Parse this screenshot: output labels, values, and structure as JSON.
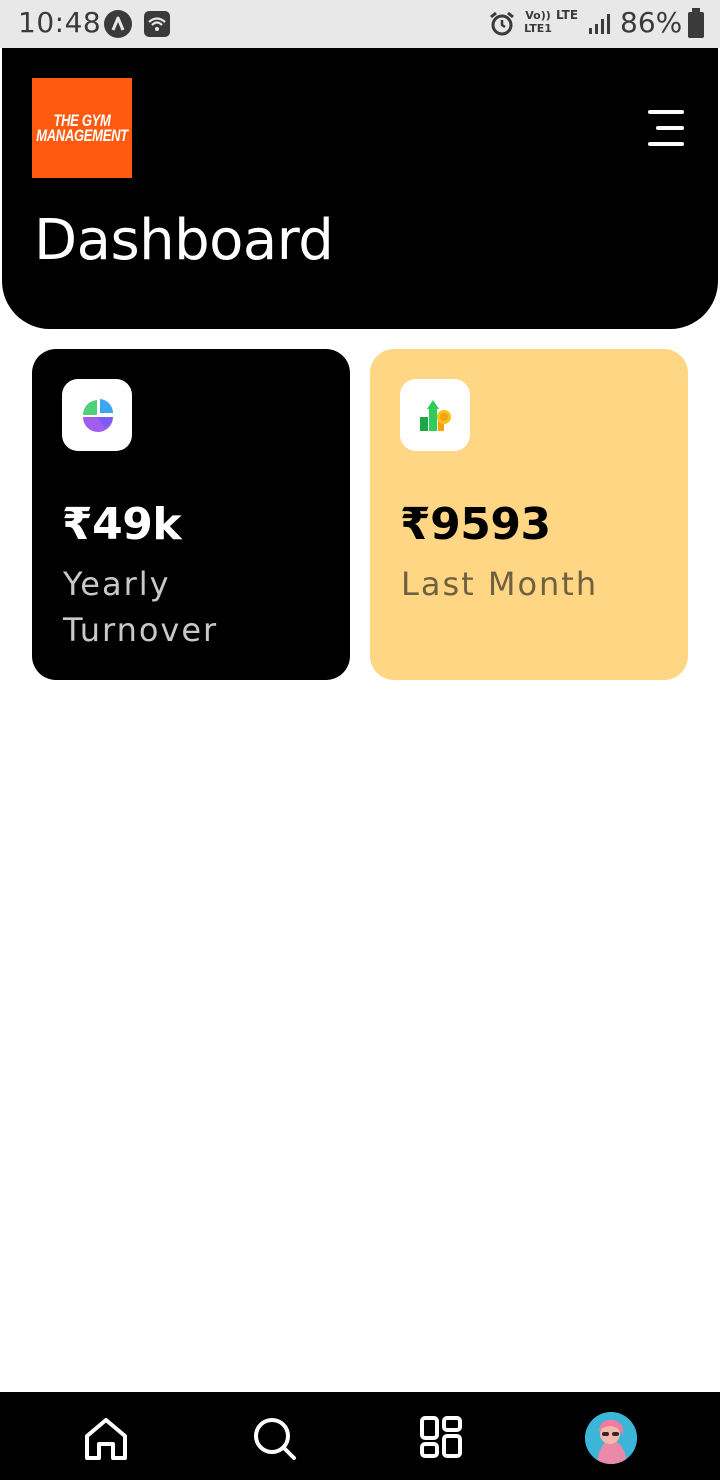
{
  "status_bar": {
    "time": "10:48",
    "battery_percent": "86%",
    "volte_label": "Vo)) LTE1",
    "lte_label": "LTE",
    "icons": [
      "app-a-icon",
      "wifi-icon",
      "alarm-icon",
      "signal-icon",
      "battery-icon"
    ]
  },
  "header": {
    "logo_line1": "THE GYM",
    "logo_line2": "MANAGEMENT",
    "title": "Dashboard",
    "logo_color": "#ff5a10",
    "menu_icon": "hamburger-menu-icon"
  },
  "cards": [
    {
      "value": "₹49k",
      "label": "Yearly Turnover",
      "background": "#000000",
      "icon": "pie-chart-icon"
    },
    {
      "value": "₹9593",
      "label": "Last Month",
      "background": "#ffd683",
      "icon": "growth-chart-icon"
    }
  ],
  "bottom_nav": {
    "items": [
      "home-icon",
      "search-icon",
      "grid-icon",
      "profile-avatar"
    ]
  }
}
